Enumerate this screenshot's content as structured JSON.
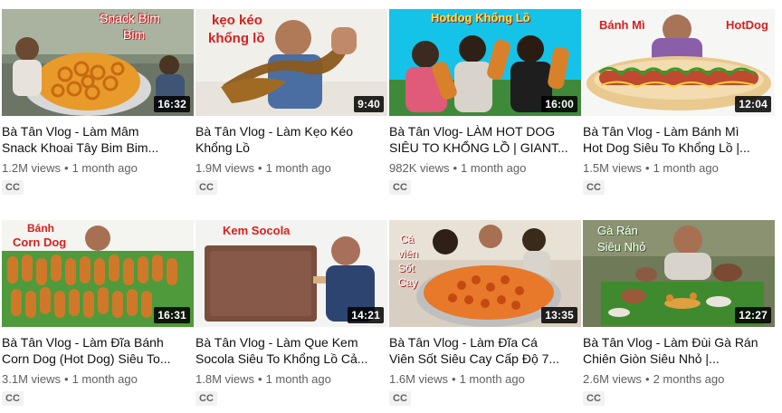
{
  "videos": [
    {
      "thumb_text": [
        "Snack Bim",
        "Bim"
      ],
      "duration": "16:32",
      "title": "Bà Tân Vlog - Làm Mâm Snack Khoai Tây Bim Bim...",
      "title_lines": [
        "Bà Tân Vlog - Làm Mâm",
        "Snack Khoai Tây Bim Bim..."
      ],
      "views": "1.2M views",
      "age": "1 month ago",
      "badge": "CC"
    },
    {
      "thumb_text": [
        "kẹo kéo",
        "khổng lồ"
      ],
      "duration": "9:40",
      "title": "Bà Tân Vlog - Làm Kẹo Kéo Khổng Lồ",
      "title_lines": [
        "Bà Tân Vlog - Làm Kẹo Kéo",
        "Khổng Lồ"
      ],
      "views": "1.9M views",
      "age": "1 month ago",
      "badge": "CC"
    },
    {
      "thumb_text": [
        "Hotdog Khổng Lồ"
      ],
      "duration": "16:00",
      "title": "Bà Tân Vlog- LÀM HOT DOG SIÊU TO KHỔNG LỒ | GIANT...",
      "title_lines": [
        "Bà Tân Vlog- LÀM HOT DOG",
        "SIÊU TO KHỔNG LỒ | GIANT..."
      ],
      "views": "982K views",
      "age": "1 month ago",
      "badge": "CC"
    },
    {
      "thumb_text": [
        "Bánh Mì",
        "HotDog"
      ],
      "duration": "12:04",
      "title": "Bà Tân Vlog - Làm Bánh Mì Hot Dog Siêu To Khổng Lồ |...",
      "title_lines": [
        "Bà Tân Vlog - Làm Bánh Mì",
        "Hot Dog Siêu To Khổng Lồ |..."
      ],
      "views": "1.5M views",
      "age": "1 month ago",
      "badge": "CC"
    },
    {
      "thumb_text": [
        "Bánh",
        "Corn Dog"
      ],
      "duration": "16:31",
      "title": "Bà Tân Vlog - Làm Đĩa Bánh Corn Dog (Hot Dog) Siêu To...",
      "title_lines": [
        "Bà Tân Vlog - Làm Đĩa Bánh",
        "Corn Dog (Hot Dog) Siêu To..."
      ],
      "views": "3.1M views",
      "age": "1 month ago",
      "badge": "CC"
    },
    {
      "thumb_text": [
        "Kem Socola"
      ],
      "duration": "14:21",
      "title": "Bà Tân Vlog - Làm Que Kem Socola Siêu To Khổng Lồ Cả...",
      "title_lines": [
        "Bà Tân Vlog - Làm Que Kem",
        "Socola Siêu To Khổng Lồ Cả..."
      ],
      "views": "1.8M views",
      "age": "1 month ago",
      "badge": "CC"
    },
    {
      "thumb_text": [
        "Cá",
        "viên",
        "Sốt",
        "Cay"
      ],
      "duration": "13:35",
      "title": "Bà Tân Vlog - Làm Đĩa Cá Viên Sốt Siêu Cay Cấp Độ 7...",
      "title_lines": [
        "Bà Tân Vlog - Làm Đĩa Cá",
        "Viên Sốt Siêu Cay Cấp Độ 7..."
      ],
      "views": "1.6M views",
      "age": "1 month ago",
      "badge": "CC"
    },
    {
      "thumb_text": [
        "Gà Rán",
        "Siêu Nhỏ"
      ],
      "duration": "12:27",
      "title": "Bà Tân Vlog - Làm Đùi Gà Rán Chiên Giòn Siêu Nhỏ |...",
      "title_lines": [
        "Bà Tân Vlog - Làm Đùi Gà Rán",
        "Chiên Giòn Siêu Nhỏ |..."
      ],
      "views": "2.6M views",
      "age": "2 months ago",
      "badge": "CC"
    }
  ],
  "meta_separator": "•"
}
